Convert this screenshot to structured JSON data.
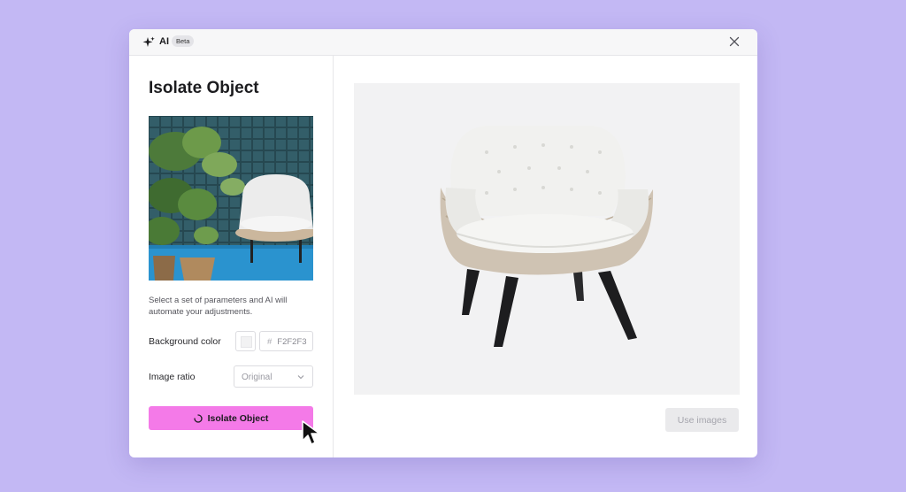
{
  "titlebar": {
    "ai_label": "AI",
    "beta_badge": "Beta",
    "close_icon": "close-icon",
    "sparkle_icon": "sparkle-icon"
  },
  "panel": {
    "title": "Isolate Object",
    "description": "Select a set of parameters and AI will automate your adjustments.",
    "background_color": {
      "label": "Background color",
      "hash": "#",
      "value": "F2F2F3",
      "swatch_color": "#F2F2F3"
    },
    "image_ratio": {
      "label": "Image ratio",
      "selected": "Original"
    },
    "isolate_button": {
      "label": "Isolate Object",
      "loading": true,
      "color": "#F47AE8"
    }
  },
  "preview": {
    "background": "#F2F2F3",
    "use_images_button": "Use images"
  },
  "colors": {
    "page_background": "#C3B8F4",
    "accent": "#F47AE8"
  }
}
